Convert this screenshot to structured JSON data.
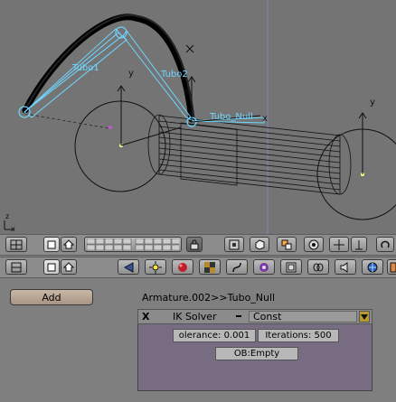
{
  "viewport": {
    "bone_labels": [
      "Tubo1",
      "Tubo2",
      "Tubo_Null"
    ],
    "axis_labels": [
      "y",
      "x"
    ],
    "corner_axis": [
      "z",
      "x"
    ]
  },
  "toolbar_1": {
    "icons": [
      "view-mode-icon",
      "display-box-icon",
      "display-home-icon",
      "layer-grid-icon",
      "lock-icon",
      "view-icon",
      "object-mode-icon",
      "pivot-icon",
      "snap-icon",
      "transform-icon",
      "manipulator-icon",
      "rotate-icon"
    ]
  },
  "toolbar_2": {
    "icons": [
      "view-mode-icon",
      "display-box-icon",
      "display-home-icon",
      "logic-icon",
      "lamp-icon",
      "material-icon",
      "texture-icon",
      "curve-icon",
      "world-icon",
      "object-icon",
      "constraint-icon",
      "sound-icon",
      "scene-icon",
      "render-icon"
    ]
  },
  "panel": {
    "add_label": "Add",
    "constraint_title": "Armature.002>>Tubo_Null",
    "close_label": "X",
    "solver_label": "IK Solver",
    "const_label": "Const",
    "tolerance_label": "olerance: 0.001",
    "iterations_label": "Iterations: 500",
    "target_label": "OB:Empty"
  },
  "colors": {
    "viewport_bg": "#747474",
    "bone_color": "#6fd6ff",
    "constraint_body": "#786c83",
    "add_button": "#b5a190"
  }
}
